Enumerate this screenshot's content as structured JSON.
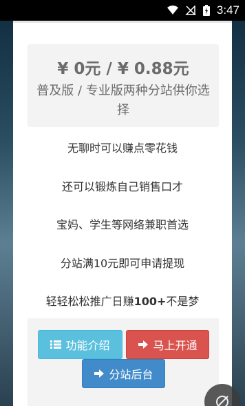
{
  "status_bar": {
    "time": "3:47"
  },
  "pricing": {
    "price_text": "¥ 0元 /  ¥ 0.88元",
    "description": "普及版 / 专业版两种分站供你选择"
  },
  "features": [
    "无聊时可以赚点零花钱",
    "还可以锻炼自己销售口才",
    "宝妈、学生等网络兼职首选",
    "分站满10元即可申请提现"
  ],
  "feature_last": {
    "prefix": "轻轻松松推广日赚",
    "highlight": "100+",
    "suffix": "不是梦"
  },
  "buttons": {
    "intro": "功能介绍",
    "open": "马上开通",
    "backend": "分站后台"
  },
  "colors": {
    "intro_button": "#5bc0de",
    "open_button": "#d9534f",
    "backend_button": "#428bca"
  }
}
